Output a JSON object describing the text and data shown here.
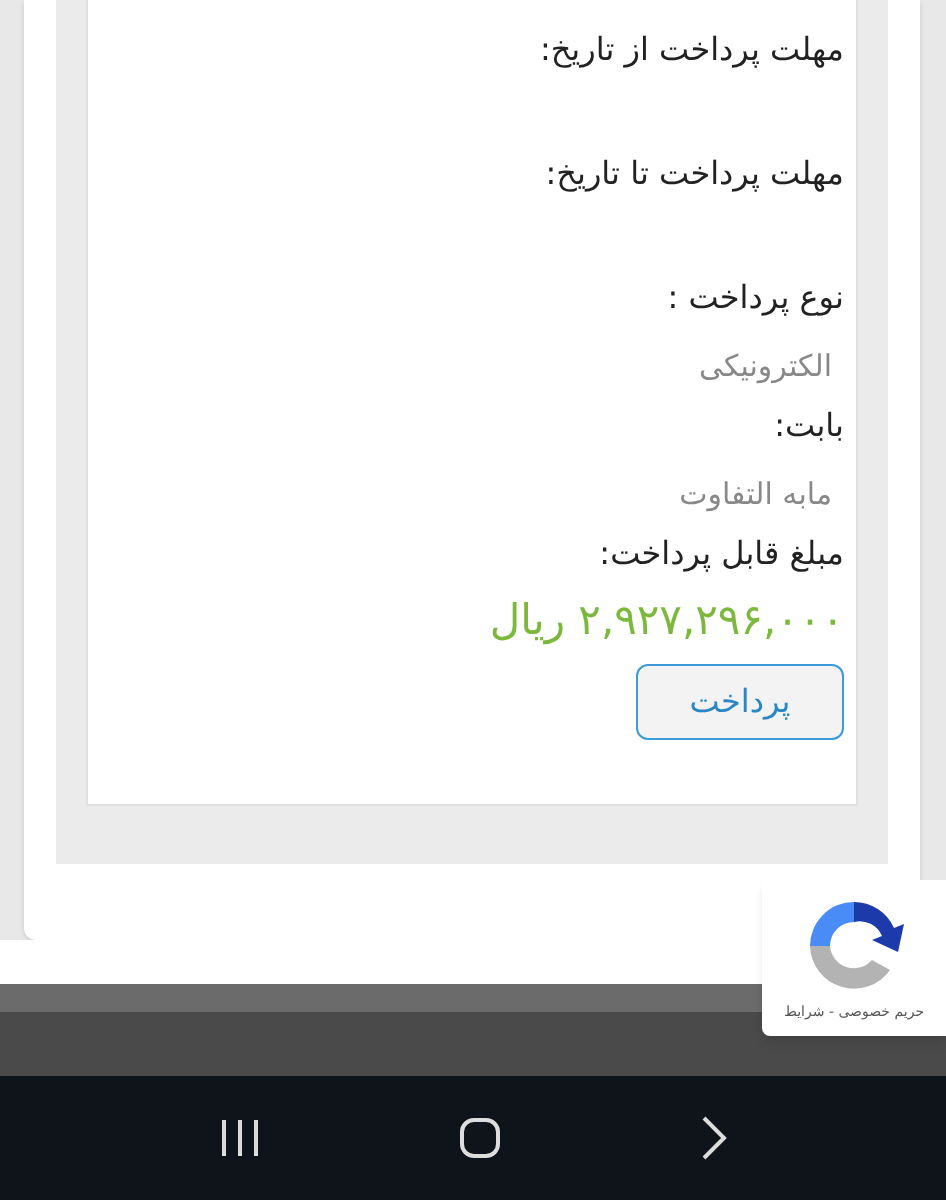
{
  "fields": [
    {
      "label": "مهلت پرداخت از تاریخ:"
    },
    {
      "label": "مهلت پرداخت تا تاریخ:"
    },
    {
      "label": "نوع پرداخت :",
      "value": "الکترونیکی"
    },
    {
      "label": "بابت:",
      "value": "مابه التفاوت"
    },
    {
      "label": "مبلغ قابل پرداخت:"
    }
  ],
  "amount": "۲,۹۲۷,۲۹۶,۰۰۰ ریال",
  "pay_button": "پرداخت",
  "recaptcha": {
    "links": "حریم خصوصی - شرایط"
  }
}
